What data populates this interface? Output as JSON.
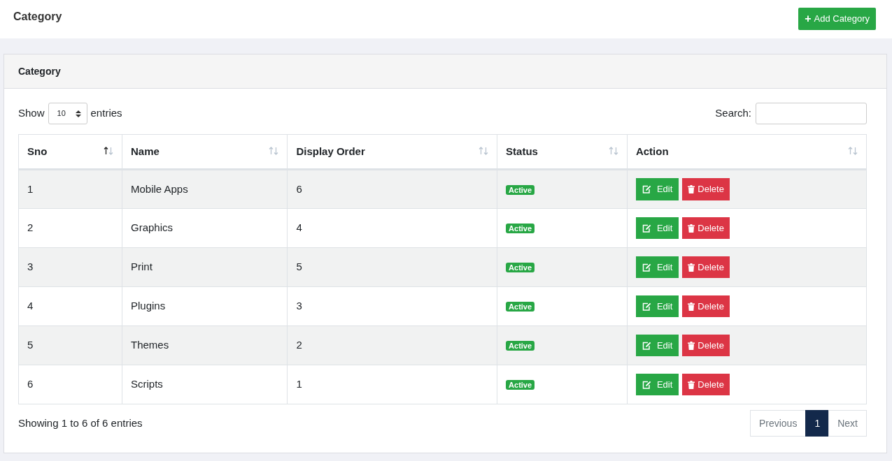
{
  "page_title": "Category",
  "add_button": {
    "icon": "+",
    "label": "Add Category"
  },
  "card": {
    "title": "Category",
    "length": {
      "before": "Show",
      "value": "10",
      "after": "entries"
    },
    "search": {
      "label": "Search:"
    },
    "table": {
      "columns": [
        {
          "label": "Sno",
          "sorted": true
        },
        {
          "label": "Name",
          "sorted": false
        },
        {
          "label": "Display Order",
          "sorted": false
        },
        {
          "label": "Status",
          "sorted": false
        },
        {
          "label": "Action",
          "sorted": false
        }
      ],
      "rows": [
        {
          "sno": "1",
          "name": "Mobile Apps",
          "order": "6",
          "status": "Active",
          "actions": [
            "Edit",
            "Delete"
          ]
        },
        {
          "sno": "2",
          "name": "Graphics",
          "order": "4",
          "status": "Active",
          "actions": [
            "Edit",
            "Delete"
          ]
        },
        {
          "sno": "3",
          "name": "Print",
          "order": "5",
          "status": "Active",
          "actions": [
            "Edit",
            "Delete"
          ]
        },
        {
          "sno": "4",
          "name": "Plugins",
          "order": "3",
          "status": "Active",
          "actions": [
            "Edit",
            "Delete"
          ]
        },
        {
          "sno": "5",
          "name": "Themes",
          "order": "2",
          "status": "Active",
          "actions": [
            "Edit",
            "Delete"
          ]
        },
        {
          "sno": "6",
          "name": "Scripts",
          "order": "1",
          "status": "Active",
          "actions": [
            "Edit",
            "Delete"
          ]
        }
      ]
    },
    "info": "Showing 1 to 6 of 6 entries",
    "pagination": {
      "previous": "Previous",
      "pages": [
        {
          "label": "1",
          "selected": true
        }
      ],
      "next": "Next"
    }
  }
}
